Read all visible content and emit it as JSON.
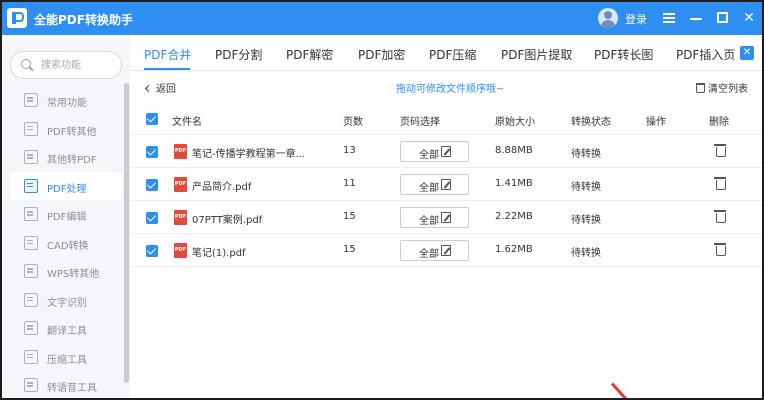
{
  "app": {
    "title": "全能PDF转换助手",
    "login_label": "登录"
  },
  "search": {
    "placeholder": "搜索功能"
  },
  "sidebar": {
    "items": [
      {
        "label": "常用功能"
      },
      {
        "label": "PDF转其他"
      },
      {
        "label": "其他转PDF"
      },
      {
        "label": "PDF处理",
        "active": true
      },
      {
        "label": "PDF编辑"
      },
      {
        "label": "CAD转换"
      },
      {
        "label": "WPS转其他"
      },
      {
        "label": "文字识别"
      },
      {
        "label": "翻译工具"
      },
      {
        "label": "压缩工具"
      },
      {
        "label": "转语音工具"
      }
    ]
  },
  "tabs": [
    {
      "label": "PDF合并",
      "active": true
    },
    {
      "label": "PDF分割"
    },
    {
      "label": "PDF解密"
    },
    {
      "label": "PDF加密"
    },
    {
      "label": "PDF压缩"
    },
    {
      "label": "PDF图片提取"
    },
    {
      "label": "PDF转长图"
    },
    {
      "label": "PDF插入页"
    }
  ],
  "toolbar": {
    "back_label": "返回",
    "hint": "拖动可修改文件顺序哦~",
    "clear_label": "清空列表"
  },
  "table": {
    "columns": {
      "name": "文件名",
      "pages": "页数",
      "page_select": "页码选择",
      "size": "原始大小",
      "status": "转换状态",
      "action": "操作",
      "delete": "删除"
    },
    "rows": [
      {
        "name": "笔记-传播学教程第一章...",
        "pages": "13",
        "page_select": "全部",
        "size": "8.88MB",
        "status": "待转换"
      },
      {
        "name": "产品简介.pdf",
        "pages": "11",
        "page_select": "全部",
        "size": "1.41MB",
        "status": "待转换"
      },
      {
        "name": "07PTT案例.pdf",
        "pages": "15",
        "page_select": "全部",
        "size": "2.22MB",
        "status": "待转换"
      },
      {
        "name": "笔记(1).pdf",
        "pages": "15",
        "page_select": "全部",
        "size": "1.62MB",
        "status": "待转换"
      }
    ]
  },
  "colors": {
    "accent": "#2e8ef2",
    "pdf_red": "#e04b3c"
  }
}
